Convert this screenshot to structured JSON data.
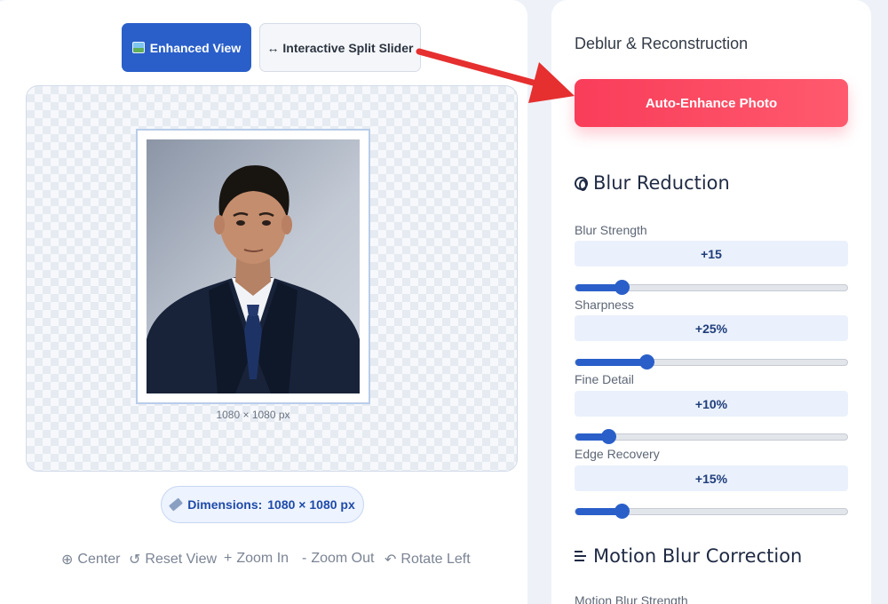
{
  "view_toggle": {
    "enhanced_label": "Enhanced View",
    "split_label": "↔ Interactive Split Slider"
  },
  "canvas": {
    "image_caption": "1080 × 1080 px"
  },
  "dimensions": {
    "label": "Dimensions:",
    "value": "1080 × 1080 px"
  },
  "tools": [
    {
      "icon": "⊕",
      "label": "Center"
    },
    {
      "icon": "↺",
      "label": "Reset View"
    },
    {
      "icon": "+",
      "label": "Zoom In"
    },
    {
      "icon": "-",
      "label": "Zoom Out"
    },
    {
      "icon": "↶",
      "label": "Rotate Left"
    }
  ],
  "panel": {
    "title": "Deblur & Reconstruction",
    "auto_enhance": "Auto-Enhance Photo",
    "blur_section": "Blur Reduction",
    "motion_section": "Motion Blur Correction",
    "motion_strength_label": "Motion Blur Strength"
  },
  "sliders": [
    {
      "label": "Blur Strength",
      "display": "+15",
      "fraction": 0.17
    },
    {
      "label": "Sharpness",
      "display": "+25%",
      "fraction": 0.26
    },
    {
      "label": "Fine Detail",
      "display": "+10%",
      "fraction": 0.12
    },
    {
      "label": "Edge Recovery",
      "display": "+15%",
      "fraction": 0.17
    }
  ],
  "colors": {
    "primary": "#2a5fc9",
    "accent": "#f93d5a",
    "annotation_arrow": "#e62f2f"
  }
}
